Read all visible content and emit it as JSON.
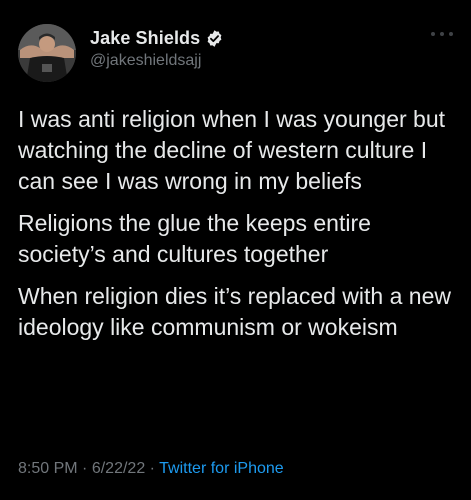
{
  "tweet": {
    "author": {
      "display_name": "Jake Shields",
      "handle": "@jakeshieldsajj",
      "verified": true
    },
    "paragraphs": [
      "I was anti religion when I was younger but watching the decline of western culture I can see I was wrong in my beliefs",
      "Religions the glue the keeps entire society’s and cultures together",
      "When religion dies it’s replaced with a new ideology like communism or wokeism"
    ],
    "time": "8:50 PM",
    "separator": "·",
    "date": "6/22/22",
    "source": "Twitter for iPhone"
  },
  "icons": {
    "verified": "verified-badge-icon",
    "more": "more-options-icon"
  },
  "colors": {
    "background": "#000000",
    "text_primary": "#e7e9ea",
    "text_secondary": "#71767b",
    "accent": "#1d9bf0"
  }
}
